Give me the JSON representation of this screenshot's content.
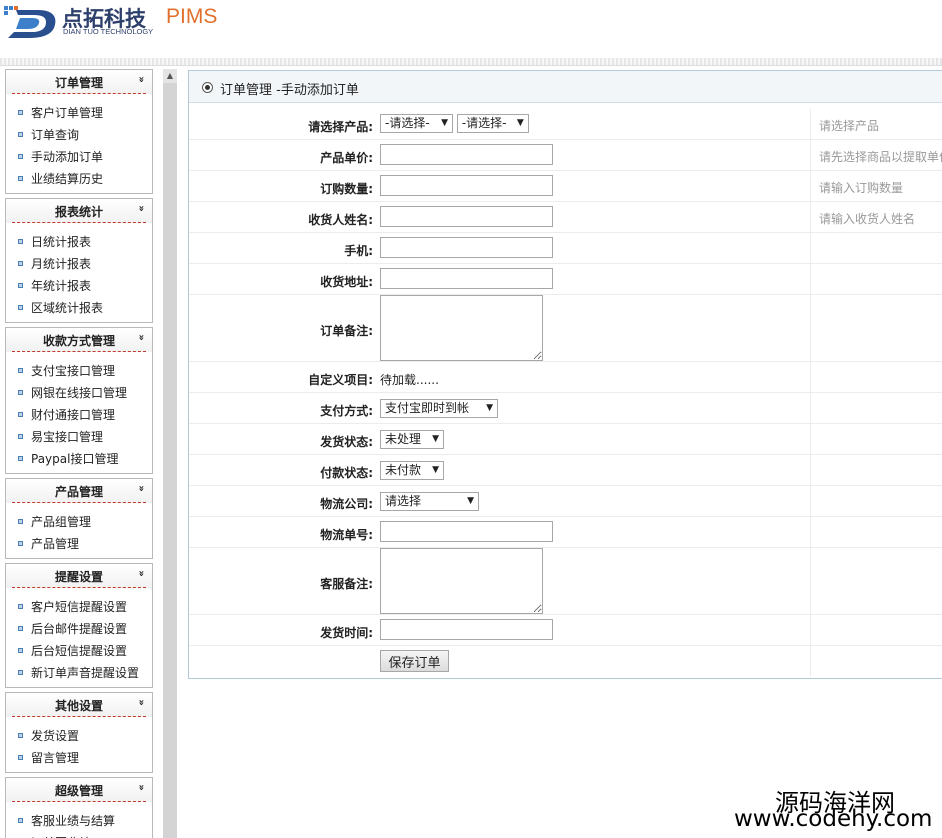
{
  "header": {
    "logo_cn": "点拓科技",
    "logo_pims": "PIMS",
    "logo_en": "DIAN TUO TECHNOLOGY"
  },
  "sidebar": {
    "groups": [
      {
        "title": "订单管理",
        "icon": "double-chevron-down-icon",
        "items": [
          "客户订单管理",
          "订单查询",
          "手动添加订单",
          "业绩结算历史"
        ]
      },
      {
        "title": "报表统计",
        "icon": "double-chevron-down-icon",
        "items": [
          "日统计报表",
          "月统计报表",
          "年统计报表",
          "区域统计报表"
        ]
      },
      {
        "title": "收款方式管理",
        "icon": "double-chevron-down-icon",
        "items": [
          "支付宝接口管理",
          "网银在线接口管理",
          "财付通接口管理",
          "易宝接口管理",
          "Paypal接口管理"
        ]
      },
      {
        "title": "产品管理",
        "icon": "double-chevron-down-icon",
        "items": [
          "产品组管理",
          "产品管理"
        ]
      },
      {
        "title": "提醒设置",
        "icon": "double-chevron-down-icon",
        "items": [
          "客户短信提醒设置",
          "后台邮件提醒设置",
          "后台短信提醒设置",
          "新订单声音提醒设置"
        ]
      },
      {
        "title": "其他设置",
        "icon": "double-chevron-down-icon",
        "items": [
          "发货设置",
          "留言管理"
        ]
      },
      {
        "title": "超级管理",
        "icon": "double-chevron-down-icon",
        "items": [
          "客服业绩与结算",
          "订单回收站"
        ]
      }
    ]
  },
  "main": {
    "title": "订单管理 -手动添加订单",
    "form": {
      "product": {
        "label": "请选择产品:",
        "select1": "-请选择-",
        "select2": "-请选择-",
        "hint": "请选择产品"
      },
      "price": {
        "label": "产品单价:",
        "value": "",
        "hint": "请先选择商品以提取单价"
      },
      "quantity": {
        "label": "订购数量:",
        "value": "",
        "hint": "请输入订购数量"
      },
      "receiver_name": {
        "label": "收货人姓名:",
        "value": "",
        "hint": "请输入收货人姓名"
      },
      "phone": {
        "label": "手机:",
        "value": ""
      },
      "address": {
        "label": "收货地址:",
        "value": ""
      },
      "order_note": {
        "label": "订单备注:",
        "value": ""
      },
      "custom": {
        "label": "自定义项目:",
        "value": "待加载......"
      },
      "payment_method": {
        "label": "支付方式:",
        "selected": "支付宝即时到帐"
      },
      "ship_status": {
        "label": "发货状态:",
        "selected": "未处理"
      },
      "pay_status": {
        "label": "付款状态:",
        "selected": "未付款"
      },
      "logistics_company": {
        "label": "物流公司:",
        "selected": "请选择"
      },
      "tracking_no": {
        "label": "物流单号:",
        "value": ""
      },
      "service_note": {
        "label": "客服备注:",
        "value": ""
      },
      "ship_time": {
        "label": "发货时间:",
        "value": ""
      },
      "save_label": "保存订单"
    }
  },
  "watermark": {
    "cn": "源码海洋网",
    "url": "www.codehy.com"
  },
  "colors": {
    "logo_blue": "#2d3f6b",
    "logo_orange": "#e0702c",
    "menu_divider": "#c0392b",
    "panel_border": "#b3c9d6"
  }
}
